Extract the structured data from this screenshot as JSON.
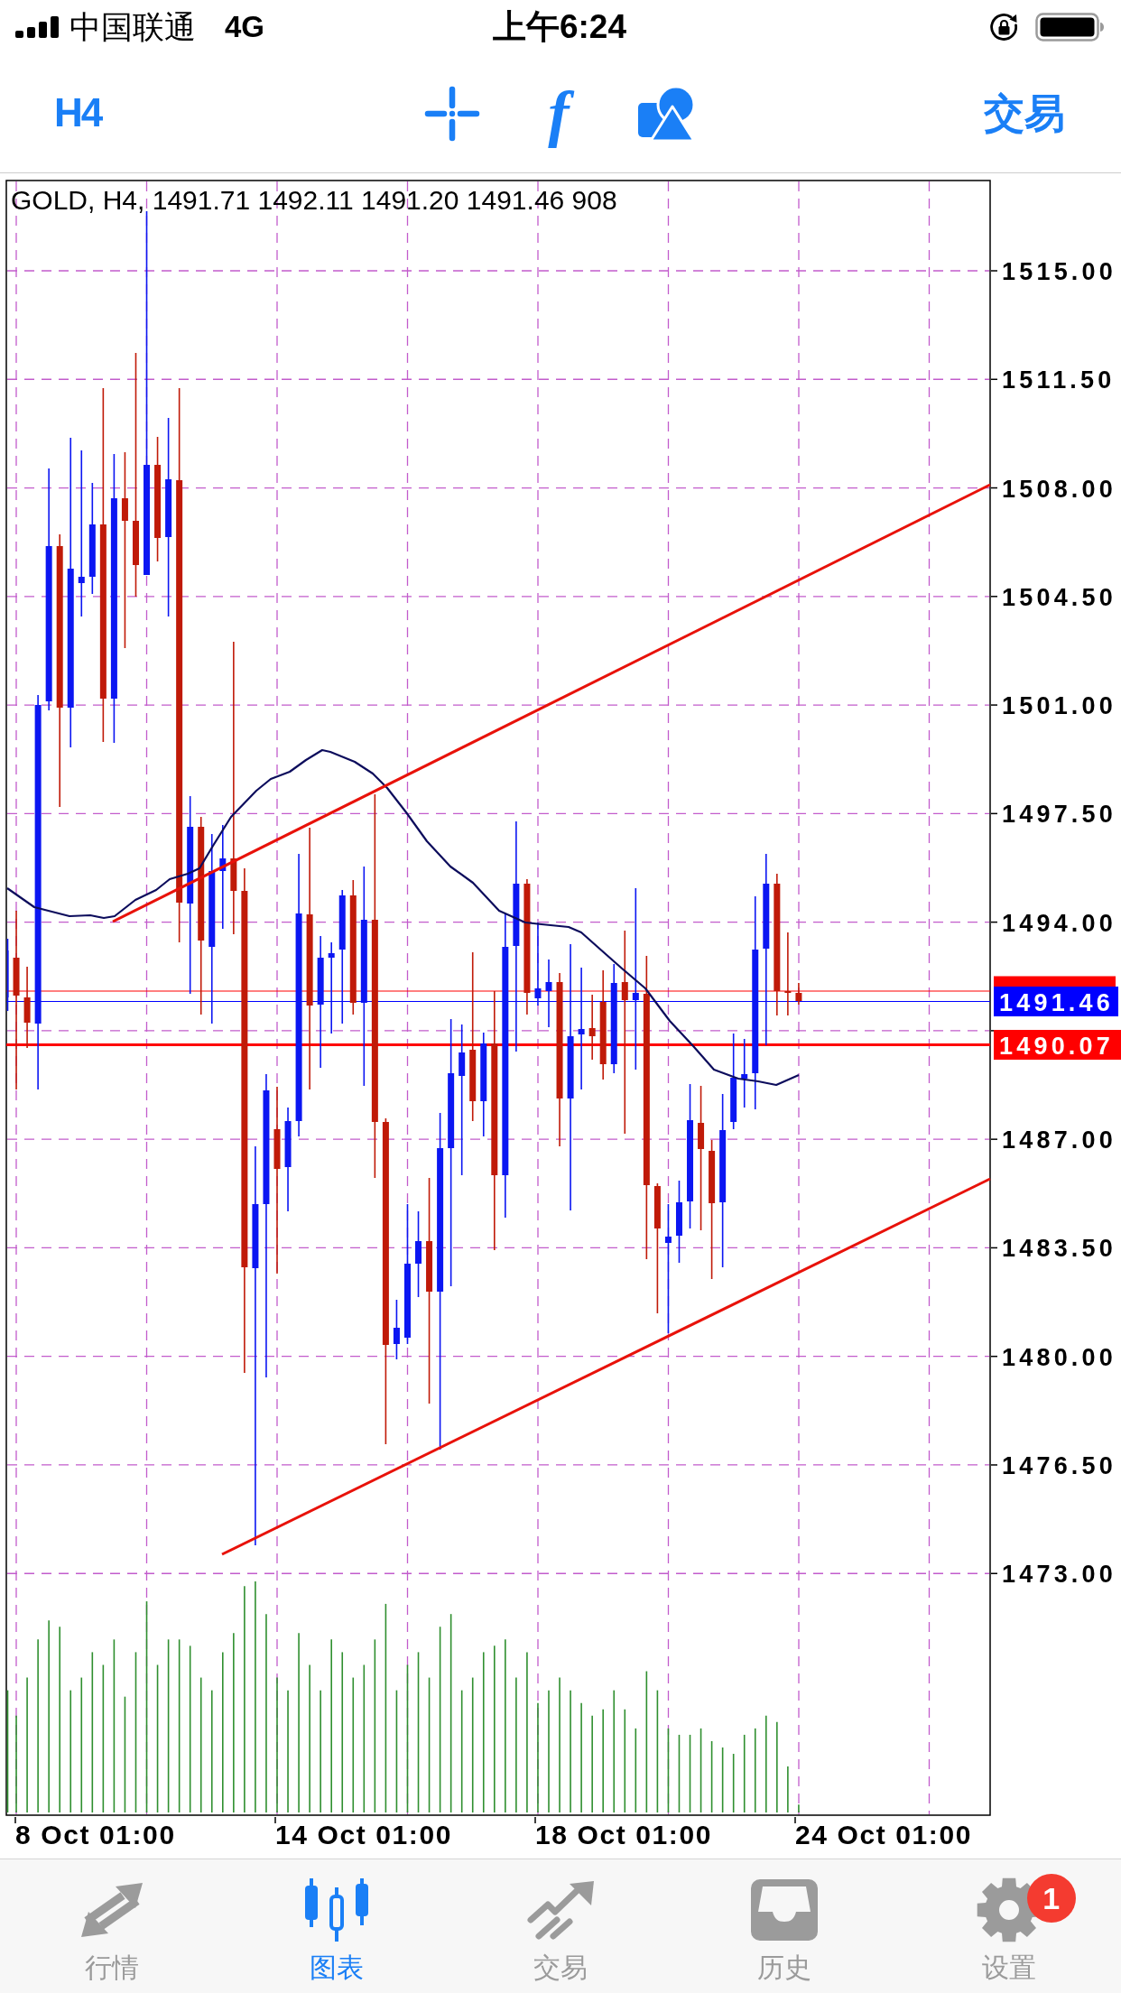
{
  "status_bar": {
    "carrier": "中国联通",
    "network": "4G",
    "time": "上午6:24"
  },
  "toolbar": {
    "timeframe": "H4",
    "tools": [
      {
        "kind": "crosshair"
      },
      {
        "kind": "function",
        "glyph": "f"
      },
      {
        "kind": "objects"
      }
    ],
    "trade": "交易"
  },
  "chart": {
    "header": "GOLD, H4, 1491.71 1492.11 1491.20 1491.46 908",
    "price_axis": [
      "1515.00",
      "1511.50",
      "1508.00",
      "1504.50",
      "1501.00",
      "1497.50",
      "1494.00",
      "1487.00",
      "1483.50",
      "1480.00",
      "1476.50",
      "1473.00"
    ],
    "price_tags": [
      {
        "kind": "ask",
        "color": "#ff0000"
      },
      {
        "kind": "bid",
        "label": "1491.46",
        "color": "#0000ff"
      },
      {
        "kind": "line",
        "label": "1490.07",
        "color": "#ff0000"
      }
    ],
    "time_axis": [
      "8 Oct 01:00",
      "14 Oct 01:00",
      "18 Oct 01:00",
      "24 Oct 01:00"
    ]
  },
  "tab_bar": {
    "tabs": [
      {
        "kind": "quotes",
        "label": "行情",
        "selected": false
      },
      {
        "kind": "chart",
        "label": "图表",
        "selected": true
      },
      {
        "kind": "trade",
        "label": "交易",
        "selected": false
      },
      {
        "kind": "history",
        "label": "历史",
        "selected": false
      },
      {
        "kind": "settings",
        "label": "设置",
        "selected": false,
        "badge": "1"
      }
    ]
  }
}
